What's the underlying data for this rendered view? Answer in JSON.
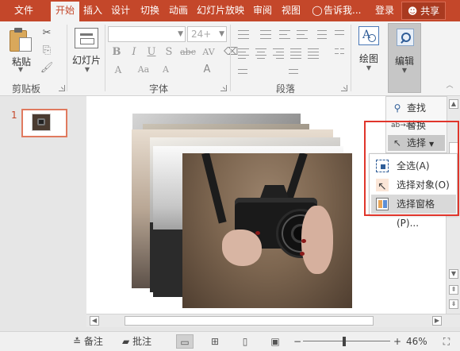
{
  "tabs": [
    {
      "label": "文件",
      "active": false
    },
    {
      "label": "开始",
      "active": true
    },
    {
      "label": "插入",
      "active": false
    },
    {
      "label": "设计",
      "active": false
    },
    {
      "label": "切换",
      "active": false
    },
    {
      "label": "动画",
      "active": false
    },
    {
      "label": "幻灯片放映",
      "active": false
    },
    {
      "label": "审阅",
      "active": false
    },
    {
      "label": "视图",
      "active": false
    }
  ],
  "tell_me": "告诉我...",
  "login": "登录",
  "share": "共享",
  "ribbon": {
    "clipboard": {
      "paste_label": "粘贴",
      "group_label": "剪贴板"
    },
    "slides": {
      "new_slide_label": "幻灯片"
    },
    "font": {
      "font_size": "24+",
      "group_label": "字体",
      "bold": "B",
      "italic": "I",
      "underline": "U",
      "shadow": "S",
      "strike": "abc",
      "spacing": "AV",
      "case": "Aa",
      "grow": "A",
      "shrink": "A"
    },
    "paragraph": {
      "group_label": "段落"
    },
    "drawing": {
      "label": "绘图"
    },
    "editing": {
      "label": "编辑"
    }
  },
  "thumbnails": {
    "slide_number": "1"
  },
  "edit_panel": {
    "find": "查找",
    "replace": "替换",
    "select": "选择",
    "icons": {
      "find": "search-icon",
      "replace": "replace-icon",
      "select": "cursor-icon"
    }
  },
  "select_menu": [
    {
      "label": "全选(A)",
      "icon": "select-all-icon"
    },
    {
      "label": "选择对象(O)",
      "icon": "select-objects-icon"
    },
    {
      "label": "选择窗格(P)...",
      "icon": "selection-pane-icon"
    }
  ],
  "status": {
    "notes": "备注",
    "comments": "批注",
    "zoom": "46%",
    "zoom_minus": "−",
    "zoom_plus": "+"
  },
  "colors": {
    "accent": "#c4472a",
    "highlight_border": "#e0352b"
  }
}
